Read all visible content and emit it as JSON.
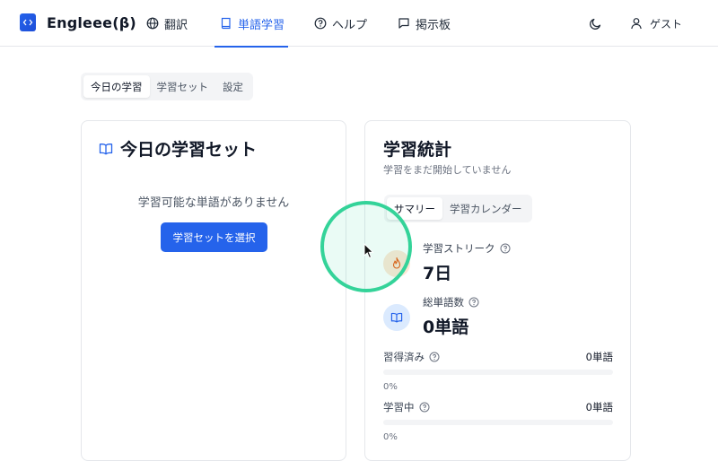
{
  "header": {
    "brand": "Engleee(β)",
    "nav": [
      {
        "label": "翻訳",
        "icon": "globe-icon"
      },
      {
        "label": "単語学習",
        "icon": "book-icon",
        "active": true
      },
      {
        "label": "ヘルプ",
        "icon": "help-circle-icon"
      },
      {
        "label": "掲示板",
        "icon": "message-square-icon"
      }
    ],
    "theme_icon": "moon-icon",
    "user_label": "ゲスト"
  },
  "main": {
    "tabs": [
      "今日の学習",
      "学習セット",
      "設定"
    ],
    "active_tab": 0,
    "today_card": {
      "title": "今日の学習セット",
      "empty_message": "学習可能な単語がありません",
      "select_button": "学習セットを選択"
    },
    "stats_card": {
      "title": "学習統計",
      "subtitle": "学習をまだ開始していません",
      "tabs": [
        "サマリー",
        "学習カレンダー"
      ],
      "streak": {
        "label": "学習ストリーク",
        "value": "7日"
      },
      "total": {
        "label": "総単語数",
        "value": "0単語"
      },
      "progress": [
        {
          "label": "習得済み",
          "count": "0単語",
          "percent_text": "0%",
          "percent": 0
        },
        {
          "label": "学習中",
          "count": "0単語",
          "percent_text": "0%",
          "percent": 0
        }
      ]
    }
  },
  "colors": {
    "accent": "#2563eb",
    "click_ripple": "#34d399"
  }
}
